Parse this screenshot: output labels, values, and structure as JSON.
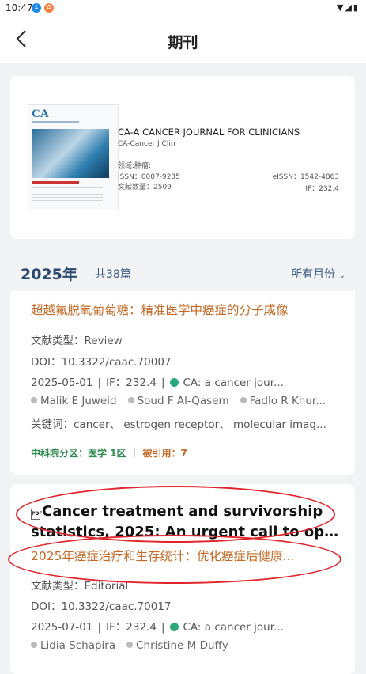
{
  "status": {
    "time": "10:47"
  },
  "header": {
    "title": "期刊"
  },
  "journal": {
    "name": "CA-A CANCER JOURNAL FOR CLINICIANS",
    "abbr": "CA-Cancer J Clin",
    "field_label": "领域:肿瘤:",
    "issn": "ISSN：0007-9235",
    "eissn": "eISSN：1542-4863",
    "articles": "文献数量：2509",
    "if": "IF：232.4",
    "cover_logo": "CA"
  },
  "filter": {
    "year": "2025年",
    "count": "共38篇",
    "month": "所有月份"
  },
  "article1": {
    "title_cn": "超越氟脱氧葡萄糖：精准医学中癌症的分子成像",
    "type": "文献类型：Review",
    "doi": "DOI：10.3322/caac.70007",
    "date": "2025-05-01",
    "if": "IF：232.4",
    "journal": "CA: a cancer jour...",
    "authors": [
      "Malik E Juweid",
      "Soud F Al-Qasem",
      "Fadlo R Khur..."
    ],
    "keywords": "关键词：cancer、 estrogen receptor、 molecular imag...",
    "zone": "中科院分区：医学 1区",
    "cited": "被引用：7"
  },
  "article2": {
    "title_en_1": "Cancer treatment and survivorship",
    "title_en_2": "statistics, 2025: An urgent call to optim...",
    "title_cn": "2025年癌症治疗和生存统计：优化癌症后健康...",
    "type": "文献类型：Editorial",
    "doi": "DOI：10.3322/caac.70017",
    "date": "2025-07-01",
    "if": "IF：232.4",
    "journal": "CA: a cancer jour...",
    "authors": [
      "Lidia Schapira",
      "Christine M Duffy"
    ]
  },
  "colors": {
    "accent": "#c46a26",
    "navy": "#2c4a6e",
    "highlight": "#e0262b",
    "green": "#2aa87a"
  }
}
